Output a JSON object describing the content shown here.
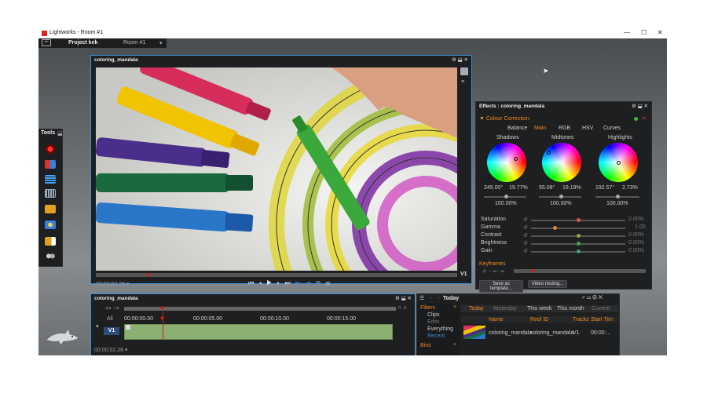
{
  "app": {
    "title": "Lightworks - Room #1"
  },
  "window_controls": {
    "minimize": "—",
    "maximize": "☐",
    "close": "✕"
  },
  "topbar": {
    "project_label": "Project kek",
    "room_label": "Room #1",
    "back_icon": "back-arrow-icon"
  },
  "tools": {
    "title": "Tools"
  },
  "viewer": {
    "title": "coloring_mandala",
    "timecode": "00:00:02.28 ▾",
    "track_label": "V1"
  },
  "effects": {
    "title": "Effects : coloring_mandala",
    "section": "Colour Correction",
    "tabs": [
      "Balance",
      "Main",
      "RGB",
      "HSV",
      "Curves"
    ],
    "active_tab": "Main",
    "wheels": [
      {
        "label": "Shadows",
        "hue": "245.00°",
        "sat": "19.77%",
        "level": "100.00%"
      },
      {
        "label": "Midtones",
        "hue": "55.08°",
        "sat": "19.19%",
        "level": "100.00%"
      },
      {
        "label": "Highlights",
        "hue": "192.57°",
        "sat": "2.73%",
        "level": "100.00%"
      }
    ],
    "params": [
      {
        "name": "Saturation",
        "value": "0.00%",
        "color": "#e05050"
      },
      {
        "name": "Gamma",
        "value": "1.00",
        "color": "#e08a30"
      },
      {
        "name": "Contrast",
        "value": "0.00%",
        "color": "#9aa040"
      },
      {
        "name": "Brightness",
        "value": "0.00%",
        "color": "#50a050"
      },
      {
        "name": "Gain",
        "value": "0.00%",
        "color": "#40a070"
      }
    ],
    "keyframes_label": "Keyframes",
    "save_button": "Save as template...",
    "routing_button": "Video routing..."
  },
  "timeline": {
    "title": "coloring_mandala",
    "ruler": [
      "00:00:00.00",
      "00:00:05.00",
      "00:00:10.00",
      "00:00:15.00"
    ],
    "all_label": "All",
    "track_label": "V1",
    "timecode": "00:00:02.28 ▾"
  },
  "bins": {
    "title": "Today",
    "filters_label": "Filters",
    "filters": [
      "Clips",
      "Edits",
      "Everything",
      "Recent"
    ],
    "bins_label": "Bins",
    "date_tabs": [
      "Today",
      "Yesterday",
      "This week",
      "This month",
      "Current"
    ],
    "columns": [
      "Name",
      "Reel ID",
      "Tracks",
      "Start Tim"
    ],
    "rows": [
      {
        "name": "coloring_mandala",
        "reel": "coloring_mandala",
        "tracks": "V1",
        "start": "00:00:..."
      }
    ]
  },
  "colors": {
    "accent_blue": "#3a8fd8",
    "accent_orange": "#f08a1c",
    "playhead_red": "#d01818"
  }
}
